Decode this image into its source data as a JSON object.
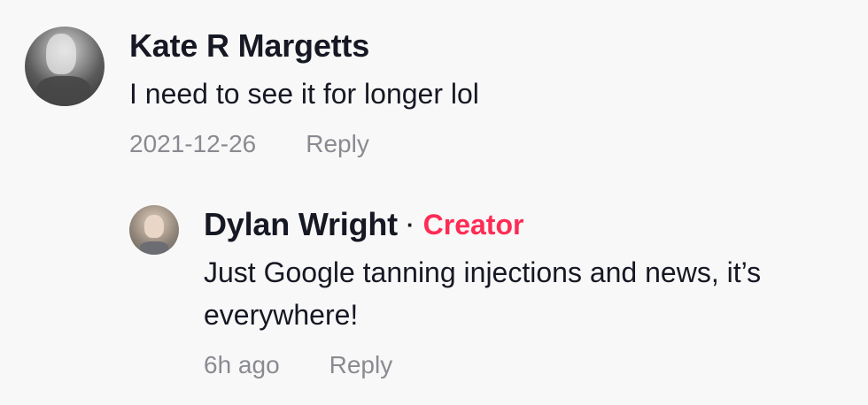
{
  "comments": [
    {
      "author": "Kate R Margetts",
      "text": "I need to see it for longer lol",
      "timestamp": "2021-12-26",
      "reply_label": "Reply"
    }
  ],
  "reply": {
    "author": "Dylan Wright",
    "separator": "·",
    "badge": "Creator",
    "text": "Just Google tanning injections and news, it’s everywhere!",
    "timestamp": "6h ago",
    "reply_label": "Reply"
  },
  "colors": {
    "creator_badge": "#fe2c55",
    "muted_text": "#8a8b91",
    "primary_text": "#161823",
    "background": "#f8f8f8"
  },
  "icons": {
    "main_avatar": "avatar",
    "reply_avatar": "avatar"
  }
}
